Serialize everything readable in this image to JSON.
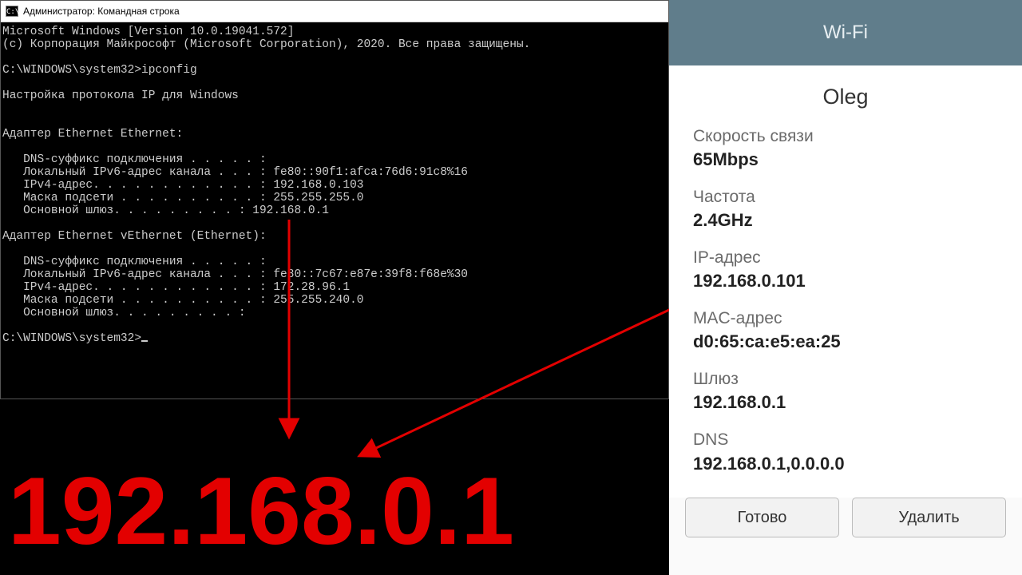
{
  "cmd": {
    "title": "Администратор: Командная строка",
    "icon_glyph": "C:\\",
    "lines": [
      "Microsoft Windows [Version 10.0.19041.572]",
      "(c) Корпорация Майкрософт (Microsoft Corporation), 2020. Все права защищены.",
      "",
      "C:\\WINDOWS\\system32>ipconfig",
      "",
      "Настройка протокола IP для Windows",
      "",
      "",
      "Адаптер Ethernet Ethernet:",
      "",
      "   DNS-суффикс подключения . . . . . :",
      "   Локальный IPv6-адрес канала . . . : fe80::90f1:afca:76d6:91c8%16",
      "   IPv4-адрес. . . . . . . . . . . . : 192.168.0.103",
      "   Маска подсети . . . . . . . . . . : 255.255.255.0",
      "   Основной шлюз. . . . . . . . . : 192.168.0.1",
      "",
      "Адаптер Ethernet vEthernet (Ethernet):",
      "",
      "   DNS-суффикс подключения . . . . . :",
      "   Локальный IPv6-адрес канала . . . : fe80::7c67:e87e:39f8:f68e%30",
      "   IPv4-адрес. . . . . . . . . . . . : 172.28.96.1",
      "   Маска подсети . . . . . . . . . . : 255.255.240.0",
      "   Основной шлюз. . . . . . . . . :",
      "",
      "C:\\WINDOWS\\system32>"
    ]
  },
  "phone": {
    "header": "Wi-Fi",
    "ssid": "Oleg",
    "fields": [
      {
        "label": "Скорость связи",
        "value": "65Mbps"
      },
      {
        "label": "Частота",
        "value": "2.4GHz"
      },
      {
        "label": "IP-адрес",
        "value": "192.168.0.101"
      },
      {
        "label": "MAC-адрес",
        "value": "d0:65:ca:e5:ea:25"
      },
      {
        "label": "Шлюз",
        "value": "192.168.0.1"
      },
      {
        "label": "DNS",
        "value": "192.168.0.1,0.0.0.0"
      }
    ],
    "buttons": {
      "done": "Готово",
      "delete": "Удалить"
    }
  },
  "annotation": {
    "big_ip": "192.168.0.1"
  }
}
